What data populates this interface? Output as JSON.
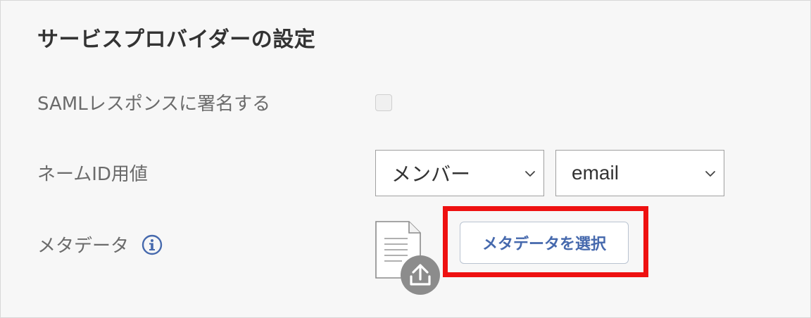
{
  "section": {
    "title": "サービスプロバイダーの設定"
  },
  "saml_sign": {
    "label": "SAMLレスポンスに署名する",
    "checked": false
  },
  "name_id": {
    "label": "ネームID用値",
    "source_select": "メンバー",
    "attribute_select": "email"
  },
  "metadata": {
    "label": "メタデータ",
    "info_icon": "info-icon",
    "file_icon": "document-upload-icon",
    "select_button_label": "メタデータを選択"
  },
  "colors": {
    "accent_blue": "#4669ad",
    "highlight_red": "#ee1111",
    "panel_bg": "#f7f7f7"
  }
}
